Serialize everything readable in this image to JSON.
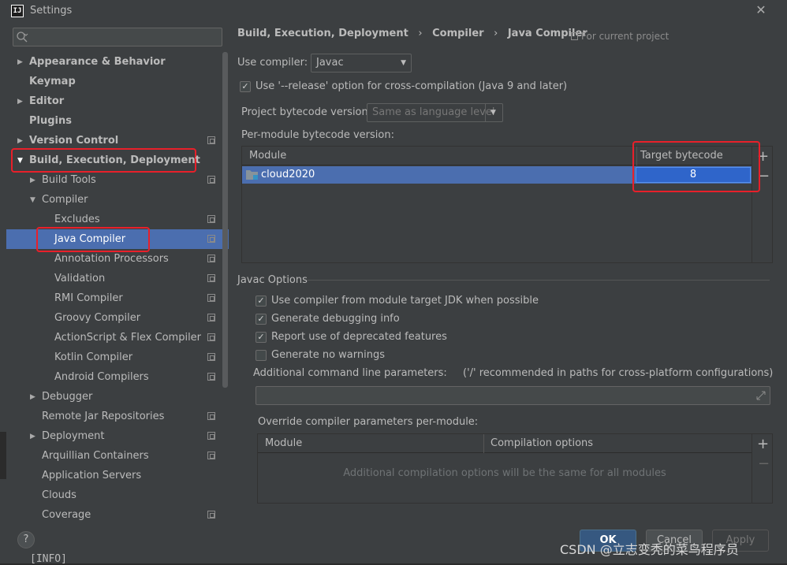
{
  "window": {
    "title": "Settings",
    "logo_text": "IJ"
  },
  "sidebar": {
    "search_placeholder": "",
    "items": [
      {
        "label": "Appearance & Behavior",
        "arrow": "▶"
      },
      {
        "label": "Keymap",
        "arrow": ""
      },
      {
        "label": "Editor",
        "arrow": "▶"
      },
      {
        "label": "Plugins",
        "arrow": ""
      },
      {
        "label": "Version Control",
        "arrow": "▶"
      },
      {
        "label": "Build, Execution, Deployment",
        "arrow": "▼"
      },
      {
        "label": "Build Tools",
        "arrow": "▶"
      },
      {
        "label": "Compiler",
        "arrow": "▼"
      },
      {
        "label": "Excludes",
        "arrow": ""
      },
      {
        "label": "Java Compiler",
        "arrow": ""
      },
      {
        "label": "Annotation Processors",
        "arrow": ""
      },
      {
        "label": "Validation",
        "arrow": ""
      },
      {
        "label": "RMI Compiler",
        "arrow": ""
      },
      {
        "label": "Groovy Compiler",
        "arrow": ""
      },
      {
        "label": "ActionScript & Flex Compiler",
        "arrow": ""
      },
      {
        "label": "Kotlin Compiler",
        "arrow": ""
      },
      {
        "label": "Android Compilers",
        "arrow": ""
      },
      {
        "label": "Debugger",
        "arrow": "▶"
      },
      {
        "label": "Remote Jar Repositories",
        "arrow": ""
      },
      {
        "label": "Deployment",
        "arrow": "▶"
      },
      {
        "label": "Arquillian Containers",
        "arrow": ""
      },
      {
        "label": "Application Servers",
        "arrow": ""
      },
      {
        "label": "Clouds",
        "arrow": ""
      },
      {
        "label": "Coverage",
        "arrow": ""
      }
    ]
  },
  "breadcrumb": {
    "part1": "Build, Execution, Deployment",
    "part2": "Compiler",
    "part3": "Java Compiler",
    "separator": "›",
    "scope": "For current project"
  },
  "compiler": {
    "use_compiler_label": "Use compiler:",
    "use_compiler_value": "Javac",
    "release_option_label": "Use '--release' option for cross-compilation (Java 9 and later)",
    "release_option_checked": true,
    "bytecode_label": "Project bytecode version:",
    "bytecode_value": "Same as language level",
    "per_module_label": "Per-module bytecode version:"
  },
  "module_table": {
    "headers": [
      "Module",
      "Target bytecode version"
    ],
    "rows": [
      {
        "module": "cloud2020",
        "version": "8"
      }
    ],
    "add_label": "+",
    "remove_label": "−"
  },
  "javac_options": {
    "section_label": "Javac Options",
    "checkboxes": [
      {
        "label": "Use compiler from module target JDK when possible",
        "checked": true
      },
      {
        "label": "Generate debugging info",
        "checked": true
      },
      {
        "label": "Report use of deprecated features",
        "checked": true
      },
      {
        "label": "Generate no warnings",
        "checked": false
      }
    ],
    "additional_params_label": "Additional command line parameters:",
    "additional_params_hint": "('/' recommended in paths for cross-platform configurations)",
    "additional_params_value": "",
    "override_label": "Override compiler parameters per-module:",
    "override_headers": [
      "Module",
      "Compilation options"
    ],
    "override_empty_text": "Additional compilation options will be the same for all modules",
    "add_label": "+",
    "remove_label": "−"
  },
  "buttons": {
    "help": "?",
    "ok": "OK",
    "cancel": "Cancel",
    "apply": "Apply"
  },
  "watermark": "CSDN @立志变秃的菜鸟程序员",
  "background_text": "[INFO]",
  "colors": {
    "background": "#3c3f41",
    "selection": "#4b6eaf",
    "highlight_box": "#e8202a",
    "ok_button": "#365880"
  }
}
